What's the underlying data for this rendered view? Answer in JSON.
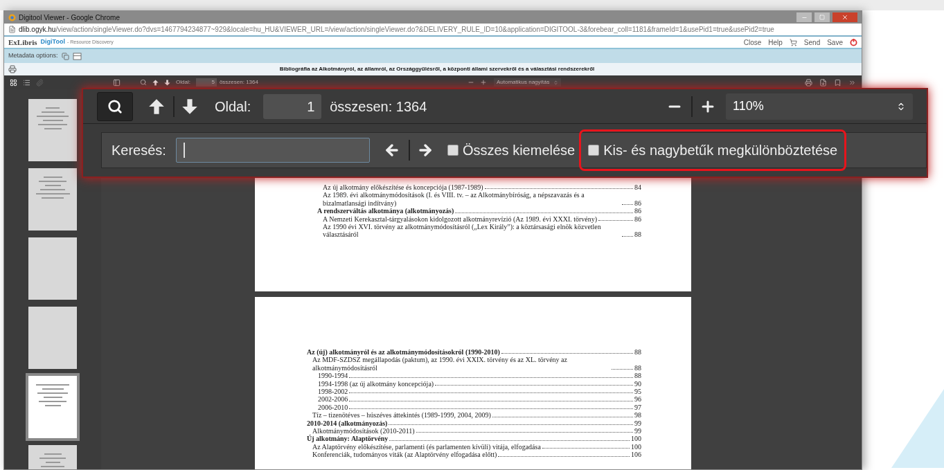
{
  "browser": {
    "title": "Digitool Viewer - Google Chrome",
    "url_host": "dlib.ogyk.hu",
    "url_path": "/view/action/singleViewer.do?dvs=1467794234877~929&locale=hu_HU&VIEWER_URL=/view/action/singleViewer.do?&DELIVERY_RULE_ID=10&application=DIGITOOL-3&forebear_coll=1181&frameId=1&usePid1=true&usePid2=true"
  },
  "header": {
    "logo": "ExLibris",
    "product": "DigiTool",
    "tagline": "- Resource Discovery",
    "actions": [
      {
        "kind": "link",
        "label": "Close"
      },
      {
        "kind": "link",
        "label": "Help"
      },
      {
        "kind": "cart"
      },
      {
        "kind": "link",
        "label": "Send"
      },
      {
        "kind": "link",
        "label": "Save"
      },
      {
        "kind": "logout"
      }
    ]
  },
  "metadata": {
    "label": "Metadata options:"
  },
  "document_title": "Bibliográfia az Alkotmányról, az államról, az Országgyűlésről, a központi állami szervekről és a választási rendszerekről",
  "viewer_toolbar": {
    "page_label": "Oldal:",
    "page": "5",
    "total": "összesen: 1364",
    "zoom": "Automatikus nagyítás"
  },
  "zoomed_toolbar": {
    "search_selected": true,
    "page_label": "Oldal:",
    "page": "1",
    "total": "összesen: 1364",
    "zoom": "110%"
  },
  "find_bar": {
    "label": "Keresés:",
    "options": [
      {
        "label": "Összes kiemelése",
        "checked": false,
        "highlighted": false
      },
      {
        "label": "Kis- és nagybetűk megkülönböztetése",
        "checked": false,
        "highlighted": true
      }
    ]
  },
  "thumbnails": [
    {
      "selected": false
    },
    {
      "selected": false
    },
    {
      "selected": false
    },
    {
      "selected": false
    },
    {
      "selected": true
    },
    {
      "selected": false
    }
  ],
  "pages": [
    {
      "toc": [
        {
          "children": [
            {
              "text": "Az új alkotmány előkészítése és koncepciója (1987-1989)",
              "page": "84"
            },
            {
              "text": "Az 1989. évi alkotmánymódosítások (I. és VIII. tv. – az Alkotmánybíróság, a népszavazás és a bizalmatlansági indítvány)",
              "page": "86"
            }
          ]
        },
        {
          "text": "A rendszerváltás alkotmánya (alkotmányozás)",
          "page": "86",
          "children": [
            {
              "text": "A Nemzeti Kerekasztal-tárgyalásokon kidolgozott alkotmányrevízió (Az 1989. évi XXXI. törvény)",
              "page": "86"
            },
            {
              "text": "Az 1990 évi XVI. törvény az alkotmánymódosításról („Lex Király”): a köztársasági elnök közvetlen választásáról",
              "page": "88"
            }
          ]
        }
      ]
    },
    {
      "toc": [
        {
          "text": "Az (új) alkotmányról és az alkotmánymódosításokról (1990-2010)",
          "page": "88",
          "children": [
            {
              "text": "Az MDF-SZDSZ megállapodás (paktum), az 1990. évi XXIX. törvény és az XL. törvény az alkotmánymódosításról",
              "page": "88",
              "children": [
                {
                  "text": "1990-1994",
                  "page": "88"
                },
                {
                  "text": "1994-1998 (az új alkotmány koncepciója)",
                  "page": "90"
                },
                {
                  "text": "1998-2002",
                  "page": "95"
                },
                {
                  "text": "2002-2006",
                  "page": "96"
                },
                {
                  "text": "2006-2010",
                  "page": "97"
                }
              ]
            },
            {
              "text": "Tíz – tizenötéves – húszéves áttekintés (1989-1999, 2004, 2009)",
              "page": "98"
            }
          ]
        },
        {
          "text": "2010-2014 (alkotmányozás)",
          "page": "99",
          "children": [
            {
              "text": "Alkotmánymódosítások (2010-2011)",
              "page": "99"
            }
          ]
        },
        {
          "text": "Új alkotmány: Alaptörvény",
          "page": "100",
          "children": [
            {
              "text": "Az Alaptörvény előkészítése, parlamenti (és parlamenten kívüli) vitája, elfogadása",
              "page": "100"
            },
            {
              "text": "Konferenciák, tudományos viták (az Alaptörvény elfogadása előtt)",
              "page": "106"
            }
          ]
        }
      ]
    }
  ]
}
